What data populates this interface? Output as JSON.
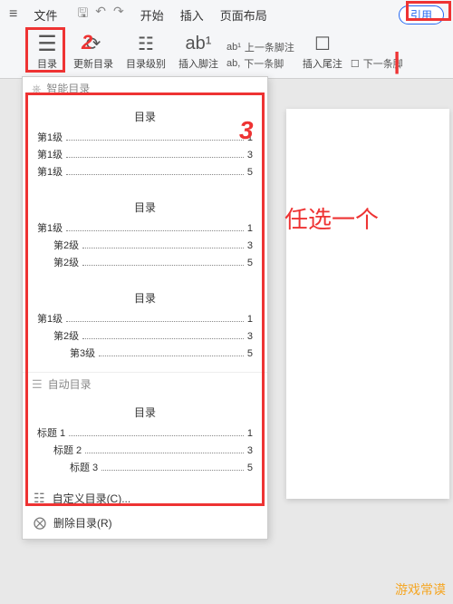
{
  "menubar": {
    "file": "文件",
    "tabs": [
      "开始",
      "插入",
      "页面布局"
    ],
    "yinyong": "引用"
  },
  "ribbon": {
    "toc": "目录",
    "update_toc": "更新目录",
    "toc_level": "目录级别",
    "insert_footnote": "插入脚注",
    "prev_footnote": "上一条脚注",
    "next_footnote_a": "下一条脚",
    "insert_endnote": "插入尾注",
    "next_footnote_b": "下一条脚"
  },
  "dropdown": {
    "smart_header": "智能目录",
    "auto_header": "自动目录",
    "custom": "自定义目录(C)...",
    "remove": "删除目录(R)",
    "samples": [
      {
        "title": "目录",
        "lines": [
          {
            "label": "第1级",
            "page": "1",
            "indent": 0
          },
          {
            "label": "第1级",
            "page": "3",
            "indent": 0
          },
          {
            "label": "第1级",
            "page": "5",
            "indent": 0
          }
        ]
      },
      {
        "title": "目录",
        "lines": [
          {
            "label": "第1级",
            "page": "1",
            "indent": 0
          },
          {
            "label": "第2级",
            "page": "3",
            "indent": 1
          },
          {
            "label": "第2级",
            "page": "5",
            "indent": 1
          }
        ]
      },
      {
        "title": "目录",
        "lines": [
          {
            "label": "第1级",
            "page": "1",
            "indent": 0
          },
          {
            "label": "第2级",
            "page": "3",
            "indent": 1
          },
          {
            "label": "第3级",
            "page": "5",
            "indent": 2
          }
        ]
      }
    ],
    "auto_sample": {
      "title": "目录",
      "lines": [
        {
          "label": "标题 1",
          "page": "1",
          "indent": 0
        },
        {
          "label": "标题 2",
          "page": "3",
          "indent": 1
        },
        {
          "label": "标题 3",
          "page": "5",
          "indent": 2
        }
      ]
    }
  },
  "annotations": {
    "num2": "2",
    "num3": "3",
    "choose": "任选一个",
    "watermark": "游戏常谟"
  }
}
